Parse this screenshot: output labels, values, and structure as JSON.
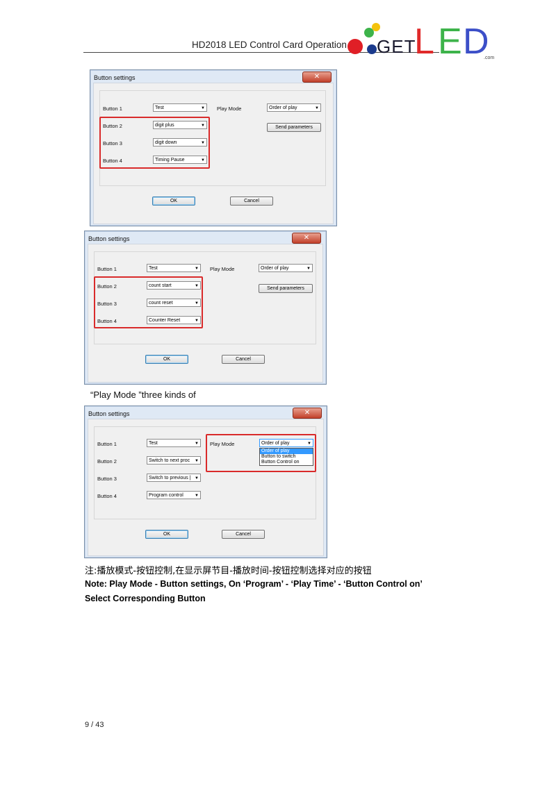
{
  "header": {
    "title": "HD2018 LED Control Card Operation ma"
  },
  "logo": {
    "get": "GET",
    "l": "L",
    "e": "E",
    "d": "D",
    "com": ".com"
  },
  "dialogs": [
    {
      "title": "Button settings",
      "close": "✕",
      "labels": {
        "b1": "Button 1",
        "b2": "Button 2",
        "b3": "Button 3",
        "b4": "Button 4",
        "play_mode": "Play Mode"
      },
      "values": {
        "b1": "Test",
        "b2": "digit plus",
        "b3": "digit down",
        "b4": "Timing Pause",
        "play_mode": "Order of play"
      },
      "send": "Send parameters",
      "ok": "OK",
      "cancel": "Cancel"
    },
    {
      "title": "Button settings",
      "close": "✕",
      "labels": {
        "b1": "Button 1",
        "b2": "Button 2",
        "b3": "Button 3",
        "b4": "Button 4",
        "play_mode": "Play Mode"
      },
      "values": {
        "b1": "Test",
        "b2": "count start",
        "b3": "count reset",
        "b4": "Counter Reset",
        "play_mode": "Order of play"
      },
      "send": "Send parameters",
      "ok": "OK",
      "cancel": "Cancel"
    },
    {
      "title": "Button settings",
      "close": "✕",
      "labels": {
        "b1": "Button 1",
        "b2": "Button 2",
        "b3": "Button 3",
        "b4": "Button 4",
        "play_mode": "Play Mode"
      },
      "values": {
        "b1": "Test",
        "b2": "Switch to next proc",
        "b3": "Switch to previous |",
        "b4": "Program control",
        "play_mode": "Order of play"
      },
      "dropdown_options": [
        "Order of play",
        "Button to switch",
        "Button Control on"
      ],
      "ok": "OK",
      "cancel": "Cancel"
    }
  ],
  "caption": "“Play Mode ”three kinds of",
  "note": {
    "cn": "注:播放模式-按钮控制,在显示屏节目-播放时间-按钮控制选择对应的按钮",
    "en1": "Note: Play Mode - Button settings, On ‘Program’ - ‘Play Time’ - ‘Button Control on’",
    "en2": "Select Corresponding Button"
  },
  "footer": {
    "page": "9 / 43"
  }
}
